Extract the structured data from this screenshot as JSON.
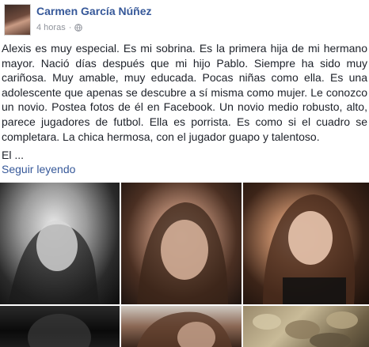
{
  "post": {
    "author": "Carmen García Núñez",
    "time": "4 horas",
    "separator": "·",
    "privacy_icon": "globe-icon",
    "text": "Alexis es muy especial. Es mi sobrina. Es la primera hija de mi hermano mayor. Nació días después que mi hijo Pablo. Siempre ha sido muy cariñosa. Muy amable, muy educada. Pocas niñas como ella. Es una adolescente que apenas se descubre a sí misma como mujer. Le conozco un novio. Postea fotos de él en Facebook. Un novio medio robusto, alto, parece jugadores de futbol. Ella es porrista. Es como si el cuadro se completara. La chica hermosa, con el jugador guapo y talentoso.",
    "truncated_text": "El ...",
    "see_more": "Seguir leyendo"
  },
  "colors": {
    "link": "#365899",
    "text": "#1d2129",
    "meta": "#90949c"
  }
}
